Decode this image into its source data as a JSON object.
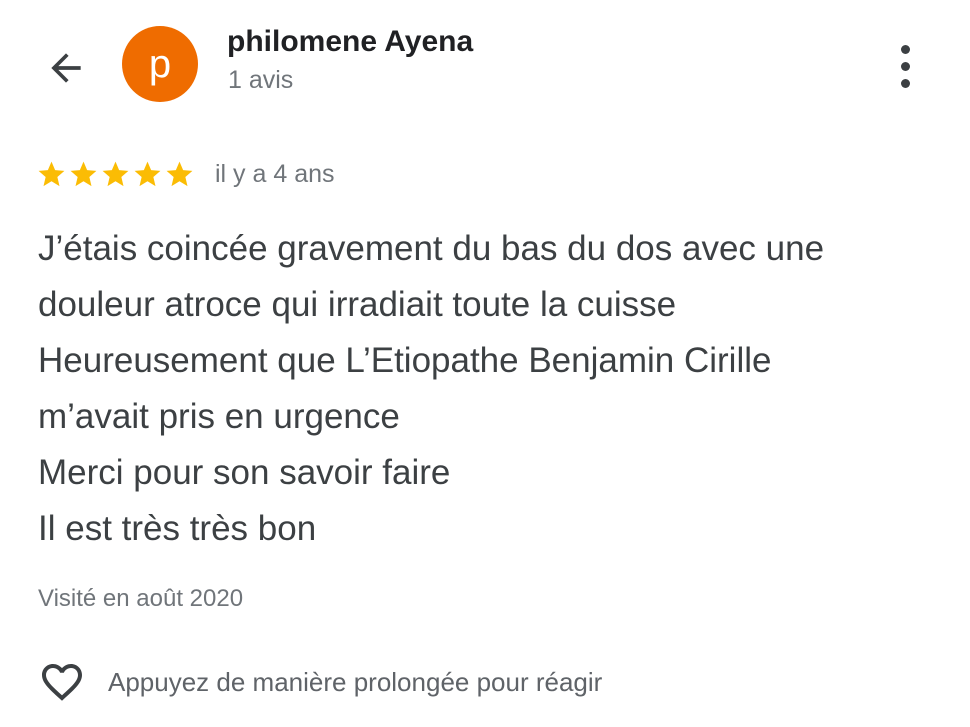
{
  "header": {
    "back_icon": "arrow-left-icon",
    "avatar_letter": "p",
    "avatar_color": "#ef6c00",
    "author_name": "philomene Ayena",
    "author_meta": "1 avis",
    "more_icon": "more-vertical-icon"
  },
  "review": {
    "rating": 5,
    "rating_max": 5,
    "star_color": "#fbbc04",
    "time": "il y a 4 ans",
    "lines": [
      "J’étais coincée gravement du bas du dos avec une",
      "douleur atroce qui irradiait toute la cuisse",
      "Heureusement que L’Etiopathe Benjamin Cirille",
      "m’avait pris en urgence",
      "Merci pour son savoir faire",
      "Il est très très bon"
    ],
    "visited": "Visité en août 2020"
  },
  "reaction": {
    "icon": "heart-outline-icon",
    "label": "Appuyez de manière prolongée pour réagir"
  }
}
